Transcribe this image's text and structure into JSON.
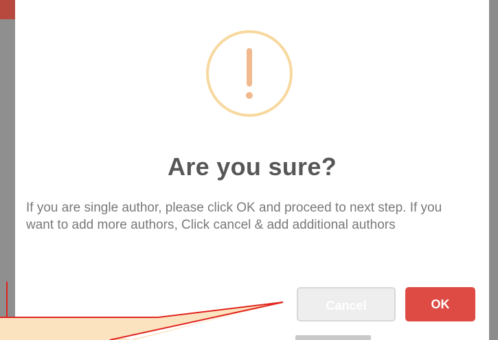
{
  "dialog": {
    "title": "Are you sure?",
    "message": "If you are single author, please click OK and proceed to next step. If you want to add more authors, Click cancel & add additional authors",
    "icon": "warning-exclamation-icon",
    "cancel_label": "Cancel",
    "ok_label": "OK"
  },
  "colors": {
    "ok_button": "#dd4b44",
    "cancel_button": "#eeeeee",
    "icon_ring": "#f7d89e",
    "icon_mark": "#f1b98d",
    "title_text": "#575757",
    "message_text": "#797979",
    "callout_fill": "#fbe3bf",
    "callout_border": "#e0231c"
  }
}
